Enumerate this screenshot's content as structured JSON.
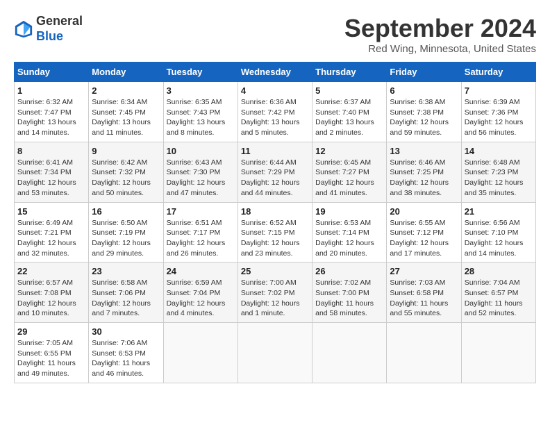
{
  "header": {
    "logo_general": "General",
    "logo_blue": "Blue",
    "month": "September 2024",
    "location": "Red Wing, Minnesota, United States"
  },
  "weekdays": [
    "Sunday",
    "Monday",
    "Tuesday",
    "Wednesday",
    "Thursday",
    "Friday",
    "Saturday"
  ],
  "weeks": [
    [
      {
        "day": "1",
        "sunrise": "Sunrise: 6:32 AM",
        "sunset": "Sunset: 7:47 PM",
        "daylight": "Daylight: 13 hours and 14 minutes."
      },
      {
        "day": "2",
        "sunrise": "Sunrise: 6:34 AM",
        "sunset": "Sunset: 7:45 PM",
        "daylight": "Daylight: 13 hours and 11 minutes."
      },
      {
        "day": "3",
        "sunrise": "Sunrise: 6:35 AM",
        "sunset": "Sunset: 7:43 PM",
        "daylight": "Daylight: 13 hours and 8 minutes."
      },
      {
        "day": "4",
        "sunrise": "Sunrise: 6:36 AM",
        "sunset": "Sunset: 7:42 PM",
        "daylight": "Daylight: 13 hours and 5 minutes."
      },
      {
        "day": "5",
        "sunrise": "Sunrise: 6:37 AM",
        "sunset": "Sunset: 7:40 PM",
        "daylight": "Daylight: 13 hours and 2 minutes."
      },
      {
        "day": "6",
        "sunrise": "Sunrise: 6:38 AM",
        "sunset": "Sunset: 7:38 PM",
        "daylight": "Daylight: 12 hours and 59 minutes."
      },
      {
        "day": "7",
        "sunrise": "Sunrise: 6:39 AM",
        "sunset": "Sunset: 7:36 PM",
        "daylight": "Daylight: 12 hours and 56 minutes."
      }
    ],
    [
      {
        "day": "8",
        "sunrise": "Sunrise: 6:41 AM",
        "sunset": "Sunset: 7:34 PM",
        "daylight": "Daylight: 12 hours and 53 minutes."
      },
      {
        "day": "9",
        "sunrise": "Sunrise: 6:42 AM",
        "sunset": "Sunset: 7:32 PM",
        "daylight": "Daylight: 12 hours and 50 minutes."
      },
      {
        "day": "10",
        "sunrise": "Sunrise: 6:43 AM",
        "sunset": "Sunset: 7:30 PM",
        "daylight": "Daylight: 12 hours and 47 minutes."
      },
      {
        "day": "11",
        "sunrise": "Sunrise: 6:44 AM",
        "sunset": "Sunset: 7:29 PM",
        "daylight": "Daylight: 12 hours and 44 minutes."
      },
      {
        "day": "12",
        "sunrise": "Sunrise: 6:45 AM",
        "sunset": "Sunset: 7:27 PM",
        "daylight": "Daylight: 12 hours and 41 minutes."
      },
      {
        "day": "13",
        "sunrise": "Sunrise: 6:46 AM",
        "sunset": "Sunset: 7:25 PM",
        "daylight": "Daylight: 12 hours and 38 minutes."
      },
      {
        "day": "14",
        "sunrise": "Sunrise: 6:48 AM",
        "sunset": "Sunset: 7:23 PM",
        "daylight": "Daylight: 12 hours and 35 minutes."
      }
    ],
    [
      {
        "day": "15",
        "sunrise": "Sunrise: 6:49 AM",
        "sunset": "Sunset: 7:21 PM",
        "daylight": "Daylight: 12 hours and 32 minutes."
      },
      {
        "day": "16",
        "sunrise": "Sunrise: 6:50 AM",
        "sunset": "Sunset: 7:19 PM",
        "daylight": "Daylight: 12 hours and 29 minutes."
      },
      {
        "day": "17",
        "sunrise": "Sunrise: 6:51 AM",
        "sunset": "Sunset: 7:17 PM",
        "daylight": "Daylight: 12 hours and 26 minutes."
      },
      {
        "day": "18",
        "sunrise": "Sunrise: 6:52 AM",
        "sunset": "Sunset: 7:15 PM",
        "daylight": "Daylight: 12 hours and 23 minutes."
      },
      {
        "day": "19",
        "sunrise": "Sunrise: 6:53 AM",
        "sunset": "Sunset: 7:14 PM",
        "daylight": "Daylight: 12 hours and 20 minutes."
      },
      {
        "day": "20",
        "sunrise": "Sunrise: 6:55 AM",
        "sunset": "Sunset: 7:12 PM",
        "daylight": "Daylight: 12 hours and 17 minutes."
      },
      {
        "day": "21",
        "sunrise": "Sunrise: 6:56 AM",
        "sunset": "Sunset: 7:10 PM",
        "daylight": "Daylight: 12 hours and 14 minutes."
      }
    ],
    [
      {
        "day": "22",
        "sunrise": "Sunrise: 6:57 AM",
        "sunset": "Sunset: 7:08 PM",
        "daylight": "Daylight: 12 hours and 10 minutes."
      },
      {
        "day": "23",
        "sunrise": "Sunrise: 6:58 AM",
        "sunset": "Sunset: 7:06 PM",
        "daylight": "Daylight: 12 hours and 7 minutes."
      },
      {
        "day": "24",
        "sunrise": "Sunrise: 6:59 AM",
        "sunset": "Sunset: 7:04 PM",
        "daylight": "Daylight: 12 hours and 4 minutes."
      },
      {
        "day": "25",
        "sunrise": "Sunrise: 7:00 AM",
        "sunset": "Sunset: 7:02 PM",
        "daylight": "Daylight: 12 hours and 1 minute."
      },
      {
        "day": "26",
        "sunrise": "Sunrise: 7:02 AM",
        "sunset": "Sunset: 7:00 PM",
        "daylight": "Daylight: 11 hours and 58 minutes."
      },
      {
        "day": "27",
        "sunrise": "Sunrise: 7:03 AM",
        "sunset": "Sunset: 6:58 PM",
        "daylight": "Daylight: 11 hours and 55 minutes."
      },
      {
        "day": "28",
        "sunrise": "Sunrise: 7:04 AM",
        "sunset": "Sunset: 6:57 PM",
        "daylight": "Daylight: 11 hours and 52 minutes."
      }
    ],
    [
      {
        "day": "29",
        "sunrise": "Sunrise: 7:05 AM",
        "sunset": "Sunset: 6:55 PM",
        "daylight": "Daylight: 11 hours and 49 minutes."
      },
      {
        "day": "30",
        "sunrise": "Sunrise: 7:06 AM",
        "sunset": "Sunset: 6:53 PM",
        "daylight": "Daylight: 11 hours and 46 minutes."
      },
      null,
      null,
      null,
      null,
      null
    ]
  ]
}
